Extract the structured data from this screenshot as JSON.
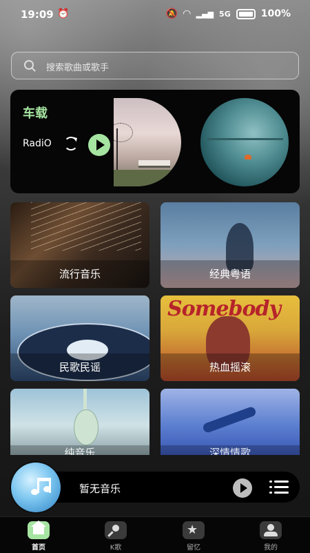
{
  "status_bar": {
    "time": "19:09",
    "battery": "100%",
    "network": "5G"
  },
  "search": {
    "placeholder": "搜索歌曲或歌手"
  },
  "radio_banner": {
    "title": "车载",
    "label": "RadiO"
  },
  "categories": [
    {
      "label": "流行音乐"
    },
    {
      "label": "经典粤语"
    },
    {
      "label": "民歌民谣"
    },
    {
      "label": "热血摇滚"
    },
    {
      "label": "纯音乐"
    },
    {
      "label": "深情情歌"
    }
  ],
  "card_art_text": "Somebody",
  "player": {
    "now_playing": "暂无音乐"
  },
  "tabs": [
    {
      "label": "首页",
      "icon": "home-icon",
      "active": true
    },
    {
      "label": "K歌",
      "icon": "microphone-icon",
      "active": false
    },
    {
      "label": "留忆",
      "icon": "star-icon",
      "active": false
    },
    {
      "label": "我的",
      "icon": "profile-icon",
      "active": false
    }
  ],
  "colors": {
    "accent": "#a6e4a1",
    "background": "#141414"
  }
}
